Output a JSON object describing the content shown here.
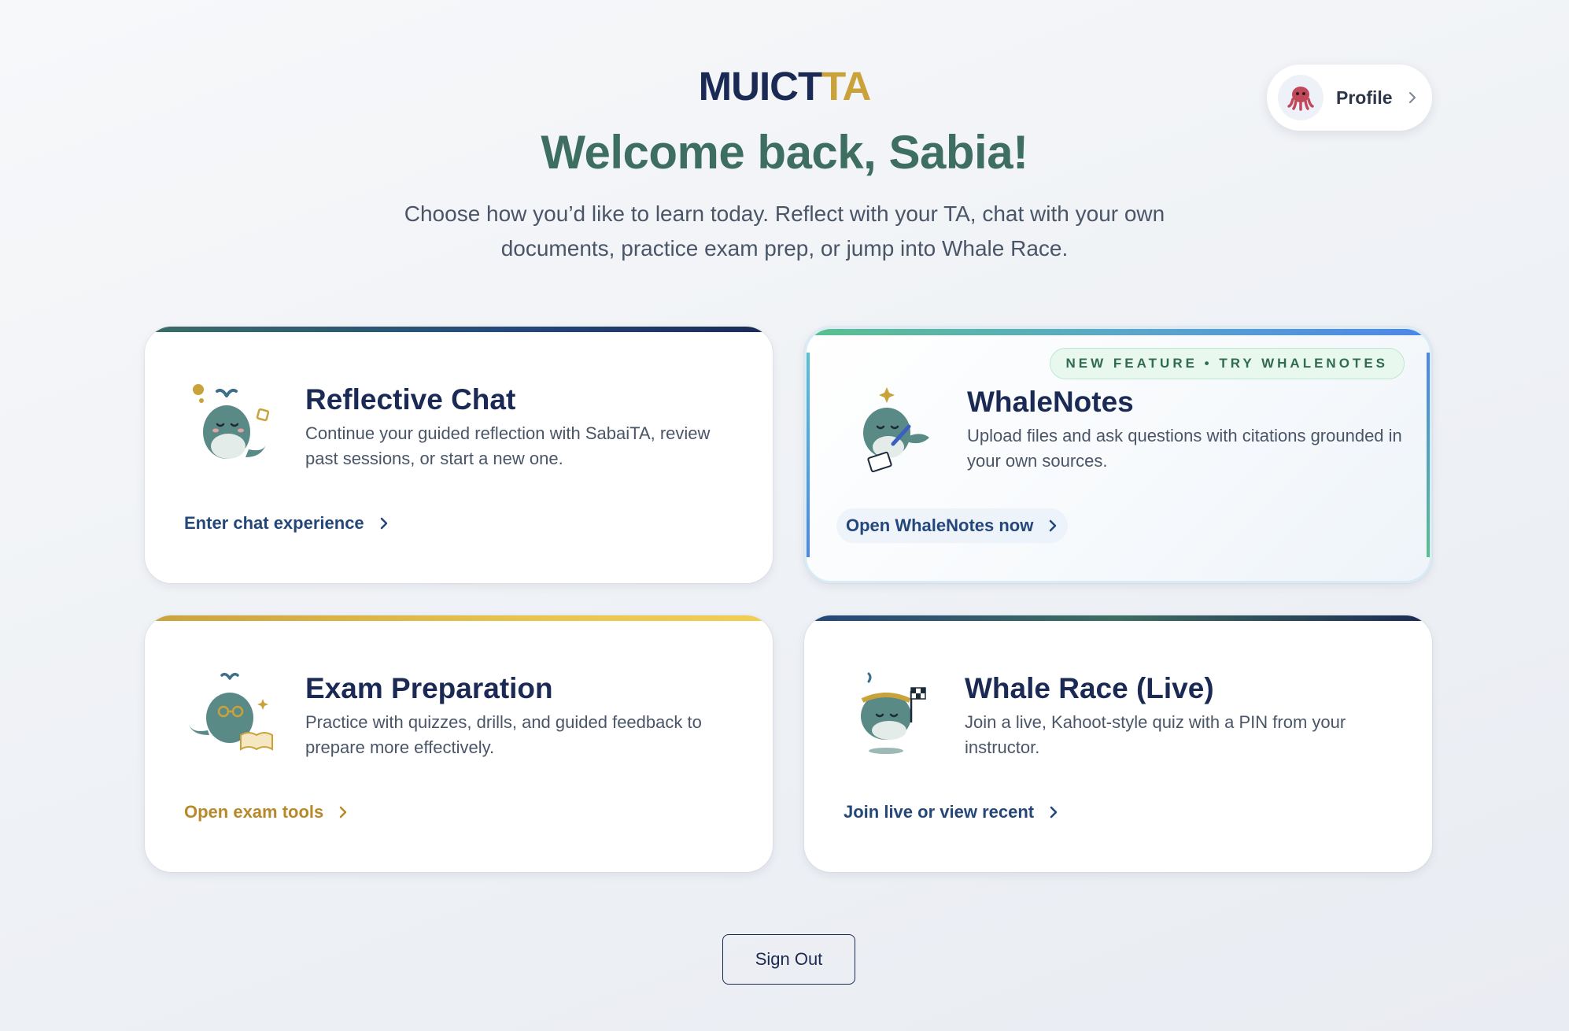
{
  "brand": {
    "part1": "MUICT",
    "part2": "TA"
  },
  "welcome": "Welcome back, Sabia!",
  "subtitle": "Choose how you’d like to learn today. Reflect with your TA, chat with your own documents, practice exam prep, or jump into Whale Race.",
  "profile": {
    "label": "Profile",
    "avatar_icon": "octopus-icon"
  },
  "cards": [
    {
      "title": "Reflective Chat",
      "desc": "Continue your guided reflection with SabaiTA, review past sessions, or start a new one.",
      "action": "Enter chat experience",
      "action_color": "#24477a"
    },
    {
      "badge": "NEW FEATURE • TRY WHALENOTES",
      "title": "WhaleNotes",
      "desc": "Upload files and ask questions with citations grounded in your own sources.",
      "action": "Open WhaleNotes now",
      "action_color": "#24477a"
    },
    {
      "title": "Exam Preparation",
      "desc": "Practice with quizzes, drills, and guided feedback to prepare more effectively.",
      "action": "Open exam tools",
      "action_color": "#b8892a"
    },
    {
      "title": "Whale Race (Live)",
      "desc": "Join a live, Kahoot-style quiz with a PIN from your instructor.",
      "action": "Join live or view recent",
      "action_color": "#24477a"
    }
  ],
  "signout": "Sign Out",
  "colors": {
    "navy": "#1b2a55",
    "gold": "#c9a23c",
    "teal": "#3d6e60"
  }
}
